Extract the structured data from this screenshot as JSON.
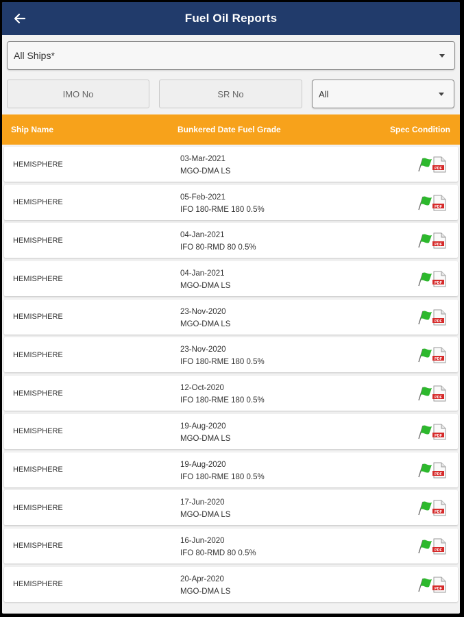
{
  "header": {
    "title": "Fuel Oil Reports"
  },
  "filters": {
    "ship_select": "All Ships*",
    "imo_placeholder": "IMO No",
    "sr_placeholder": "SR No",
    "grade_select": "All"
  },
  "table": {
    "columns": [
      "Ship Name",
      "Bunkered Date Fuel Grade",
      "Spec Condition"
    ],
    "rows": [
      {
        "ship": "HEMISPHERE",
        "date": "03-Mar-2021",
        "grade": "MGO-DMA LS"
      },
      {
        "ship": "HEMISPHERE",
        "date": "05-Feb-2021",
        "grade": "IFO 180-RME 180 0.5%"
      },
      {
        "ship": "HEMISPHERE",
        "date": "04-Jan-2021",
        "grade": "IFO 80-RMD 80 0.5%"
      },
      {
        "ship": "HEMISPHERE",
        "date": "04-Jan-2021",
        "grade": "MGO-DMA LS"
      },
      {
        "ship": "HEMISPHERE",
        "date": "23-Nov-2020",
        "grade": "MGO-DMA LS"
      },
      {
        "ship": "HEMISPHERE",
        "date": "23-Nov-2020",
        "grade": "IFO 180-RME 180 0.5%"
      },
      {
        "ship": "HEMISPHERE",
        "date": "12-Oct-2020",
        "grade": "IFO 180-RME 180 0.5%"
      },
      {
        "ship": "HEMISPHERE",
        "date": "19-Aug-2020",
        "grade": "MGO-DMA LS"
      },
      {
        "ship": "HEMISPHERE",
        "date": "19-Aug-2020",
        "grade": "IFO 180-RME 180 0.5%"
      },
      {
        "ship": "HEMISPHERE",
        "date": "17-Jun-2020",
        "grade": "MGO-DMA LS"
      },
      {
        "ship": "HEMISPHERE",
        "date": "16-Jun-2020",
        "grade": "IFO 80-RMD 80 0.5%"
      },
      {
        "ship": "HEMISPHERE",
        "date": "20-Apr-2020",
        "grade": "MGO-DMA LS"
      }
    ]
  },
  "icons": {
    "back": "arrow-left-icon",
    "flag": "green-flag-icon",
    "pdf": "pdf-file-icon"
  },
  "colors": {
    "appbar": "#213b6b",
    "header": "#f7a21b",
    "flag": "#2db82d",
    "pdf": "#d62b2b"
  }
}
